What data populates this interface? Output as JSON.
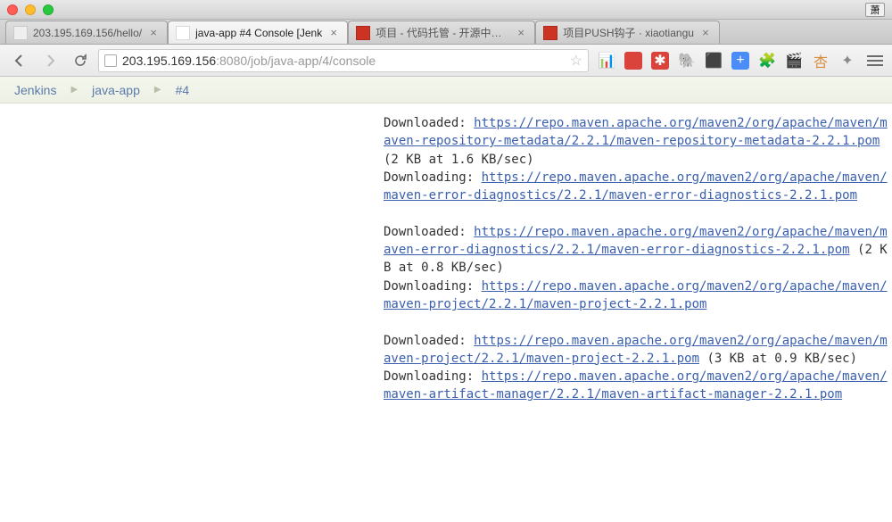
{
  "titlebar": {
    "user_badge": "萧"
  },
  "tabs": [
    {
      "label": "203.195.169.156/hello/",
      "active": false,
      "icon_bg": "#eee"
    },
    {
      "label": "java-app #4 Console [Jenk",
      "active": true,
      "icon_bg": "#fff"
    },
    {
      "label": "项目 - 代码托管 - 开源中国社",
      "active": false,
      "icon_bg": "#c32"
    },
    {
      "label": "项目PUSH钩子 · xiaotiangu",
      "active": false,
      "icon_bg": "#c32"
    }
  ],
  "url": {
    "host": "203.195.169.156",
    "port": ":8080",
    "path": "/job/java-app/4/console"
  },
  "breadcrumb": [
    "Jenkins",
    "java-app",
    "#4"
  ],
  "extensions": [
    {
      "bg": "transparent",
      "glyph": "📊"
    },
    {
      "bg": "#d9433b",
      "glyph": ""
    },
    {
      "bg": "#d9433b",
      "glyph": "✱",
      "color": "#fff"
    },
    {
      "bg": "transparent",
      "glyph": "🐘"
    },
    {
      "bg": "transparent",
      "glyph": "⬛"
    },
    {
      "bg": "#4b8df8",
      "glyph": "+",
      "color": "#fff"
    },
    {
      "bg": "transparent",
      "glyph": "🧩"
    },
    {
      "bg": "transparent",
      "glyph": "🎬"
    },
    {
      "bg": "transparent",
      "glyph": "杏",
      "color": "#d98b3b"
    },
    {
      "bg": "transparent",
      "glyph": "✦",
      "color": "#888"
    }
  ],
  "console_lines": [
    {
      "t": "text",
      "v": "Downloaded: "
    },
    {
      "t": "link",
      "v": "https://repo.maven.apache.org/maven2/org/apache/maven/maven-repository-metadata/2.2.1/maven-repository-metadata-2.2.1.pom"
    },
    {
      "t": "text",
      "v": " (2 KB at 1.6 KB/sec)"
    },
    {
      "t": "br"
    },
    {
      "t": "text",
      "v": "Downloading: "
    },
    {
      "t": "link",
      "v": "https://repo.maven.apache.org/maven2/org/apache/maven/maven-error-diagnostics/2.2.1/maven-error-diagnostics-2.2.1.pom"
    },
    {
      "t": "br"
    },
    {
      "t": "br"
    },
    {
      "t": "text",
      "v": "Downloaded: "
    },
    {
      "t": "link",
      "v": "https://repo.maven.apache.org/maven2/org/apache/maven/maven-error-diagnostics/2.2.1/maven-error-diagnostics-2.2.1.pom"
    },
    {
      "t": "text",
      "v": " (2 KB at 0.8 KB/sec)"
    },
    {
      "t": "br"
    },
    {
      "t": "text",
      "v": "Downloading: "
    },
    {
      "t": "link",
      "v": "https://repo.maven.apache.org/maven2/org/apache/maven/maven-project/2.2.1/maven-project-2.2.1.pom"
    },
    {
      "t": "br"
    },
    {
      "t": "br"
    },
    {
      "t": "text",
      "v": "Downloaded: "
    },
    {
      "t": "link",
      "v": "https://repo.maven.apache.org/maven2/org/apache/maven/maven-project/2.2.1/maven-project-2.2.1.pom"
    },
    {
      "t": "text",
      "v": " (3 KB at 0.9 KB/sec)"
    },
    {
      "t": "br"
    },
    {
      "t": "text",
      "v": "Downloading: "
    },
    {
      "t": "link",
      "v": "https://repo.maven.apache.org/maven2/org/apache/maven/maven-artifact-manager/2.2.1/maven-artifact-manager-2.2.1.pom"
    }
  ]
}
